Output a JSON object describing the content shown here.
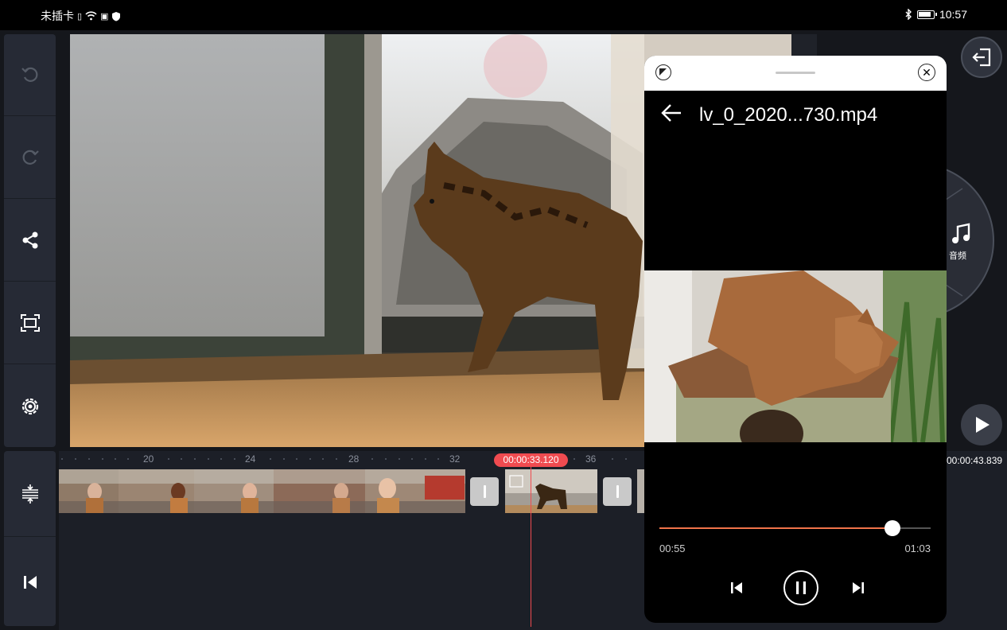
{
  "status_bar": {
    "carrier": "未插卡",
    "time": "10:57"
  },
  "toolbar": {
    "undo": "undo-icon",
    "redo": "redo-icon",
    "share": "share-icon",
    "crop": "crop-icon",
    "settings": "settings-icon",
    "track_adjust": "track-adjust-icon",
    "jump_start": "skip-to-start-icon"
  },
  "timeline": {
    "ruler_labels": [
      "20",
      "24",
      "28",
      "32",
      "36"
    ],
    "playhead_time": "00:00:33.120",
    "total_time": "00:00:43.839"
  },
  "side_panel": {
    "audio_label": "音频"
  },
  "player": {
    "title": "lv_0_2020...730.mp4",
    "current_time": "00:55",
    "duration": "01:03",
    "progress": 0.86
  },
  "colors": {
    "accent": "#f04b50",
    "seek": "#f0734a"
  }
}
